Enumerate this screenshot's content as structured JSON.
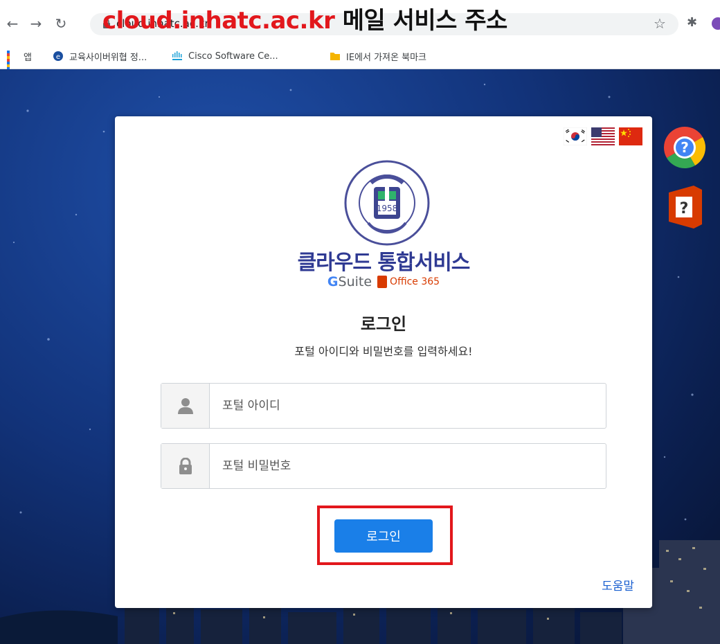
{
  "overlay": {
    "domain_text": "cloud.inhatc.ac.kr",
    "caption_text": "메일 서비스 주소"
  },
  "browser": {
    "url": "cloud.inhatc.ac.kr",
    "bookmarks": [
      {
        "label": "앱",
        "icon": "apps-grid-icon"
      },
      {
        "label": "교육사이버위협 정...",
        "icon": "shield-bookmark-icon"
      },
      {
        "label": "Cisco Software Ce...",
        "icon": "cisco-icon"
      },
      {
        "label": "IE에서 가져온 북마크",
        "icon": "folder-icon"
      }
    ]
  },
  "card": {
    "brand_title": "클라우드 통합서비스",
    "gsuite_label": "Suite",
    "gsuite_g": "G",
    "office_label": "Office 365",
    "emblem_year": "1958",
    "login_title": "로그인",
    "login_desc": "포털 아이디와 비밀번호를 입력하세요!",
    "id_placeholder": "포털 아이디",
    "pw_placeholder": "포털 비밀번호",
    "login_button": "로그인",
    "help_link": "도움말"
  },
  "colors": {
    "accent": "#1a7fe8",
    "highlight": "#e2171c",
    "brand": "#2f3a93"
  }
}
